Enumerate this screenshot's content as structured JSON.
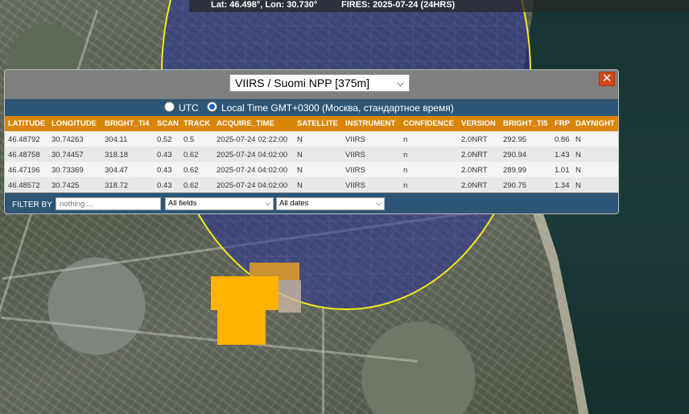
{
  "status": {
    "coords": "Lat: 46.498°, Lon: 30.730°",
    "fires": "FIRES: 2025-07-24 (24HRS)"
  },
  "panel": {
    "source_select": "VIIRS / Suomi NPP [375m]",
    "close_label": "✕",
    "timezone": {
      "utc_label": "UTC",
      "local_label": "Local Time GMT+0300 (Москва, стандартное время)",
      "selected": "local"
    },
    "columns": [
      "LATITUDE",
      "LONGITUDE",
      "BRIGHT_TI4",
      "SCAN",
      "TRACK",
      "ACQUIRE_TIME",
      "SATELLITE",
      "INSTRUMENT",
      "CONFIDENCE",
      "VERSION",
      "BRIGHT_TI5",
      "FRP",
      "DAYNIGHT"
    ],
    "rows": [
      [
        "46.48792",
        "30.74263",
        "304.11",
        "0.52",
        "0.5",
        "2025-07-24 02:22:00",
        "N",
        "VIIRS",
        "n",
        "2.0NRT",
        "292.95",
        "0.86",
        "N"
      ],
      [
        "46.48758",
        "30.74457",
        "318.18",
        "0.43",
        "0.62",
        "2025-07-24 04:02:00",
        "N",
        "VIIRS",
        "n",
        "2.0NRT",
        "290.94",
        "1.43",
        "N"
      ],
      [
        "46.47196",
        "30.73369",
        "304.47",
        "0.43",
        "0.62",
        "2025-07-24 04:02:00",
        "N",
        "VIIRS",
        "n",
        "2.0NRT",
        "289.99",
        "1.01",
        "N"
      ],
      [
        "46.48572",
        "30.7425",
        "318.72",
        "0.43",
        "0.62",
        "2025-07-24 04:02:00",
        "N",
        "VIIRS",
        "n",
        "2.0NRT",
        "290.75",
        "1.34",
        "N"
      ]
    ],
    "filter": {
      "label": "FILTER BY",
      "placeholder": "nothing ...",
      "field_select": "All fields",
      "date_select": "All dates"
    }
  },
  "colors": {
    "header_orange": "#d9850a",
    "panel_blue": "#2d5676",
    "circle_yellow": "#f2ea16",
    "fire_orange": "#ffb300",
    "close_red": "#d2461b"
  }
}
